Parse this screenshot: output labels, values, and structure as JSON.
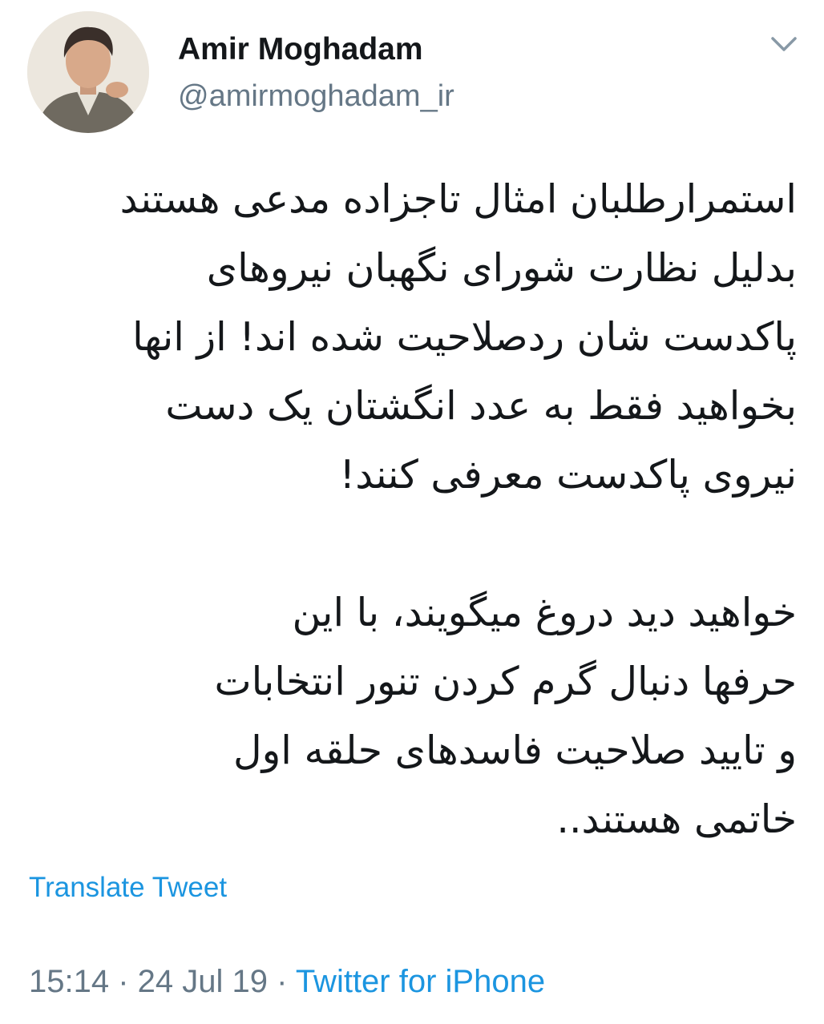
{
  "author": {
    "display_name": "Amir Moghadam",
    "handle": "@amirmoghadam_ir"
  },
  "tweet": {
    "paragraph1": [
      "استمرارطلبان امثال تاجزاده مدعی هستند",
      "بدلیل نظارت شورای نگهبان نیروهای",
      "پاکدست شان ردصلاحیت شده اند! از انها",
      "بخواهید فقط به عدد انگشتان یک دست",
      "نیروی پاکدست معرفی کنند!"
    ],
    "paragraph2": [
      "خواهید دید دروغ میگویند، با این",
      "حرفها دنبال گرم کردن تنور انتخابات",
      "و تایید صلاحیت فاسدهای حلقه اول",
      "خاتمی هستند.."
    ]
  },
  "translate_label": "Translate Tweet",
  "meta": {
    "time": "15:14",
    "separator": " · ",
    "date": "24 Jul 19",
    "source": "Twitter for iPhone"
  },
  "colors": {
    "link": "#1b95e0",
    "muted": "#657786",
    "text": "#14171a"
  },
  "icons": {
    "menu": "chevron-down-icon",
    "avatar": "profile-photo"
  }
}
